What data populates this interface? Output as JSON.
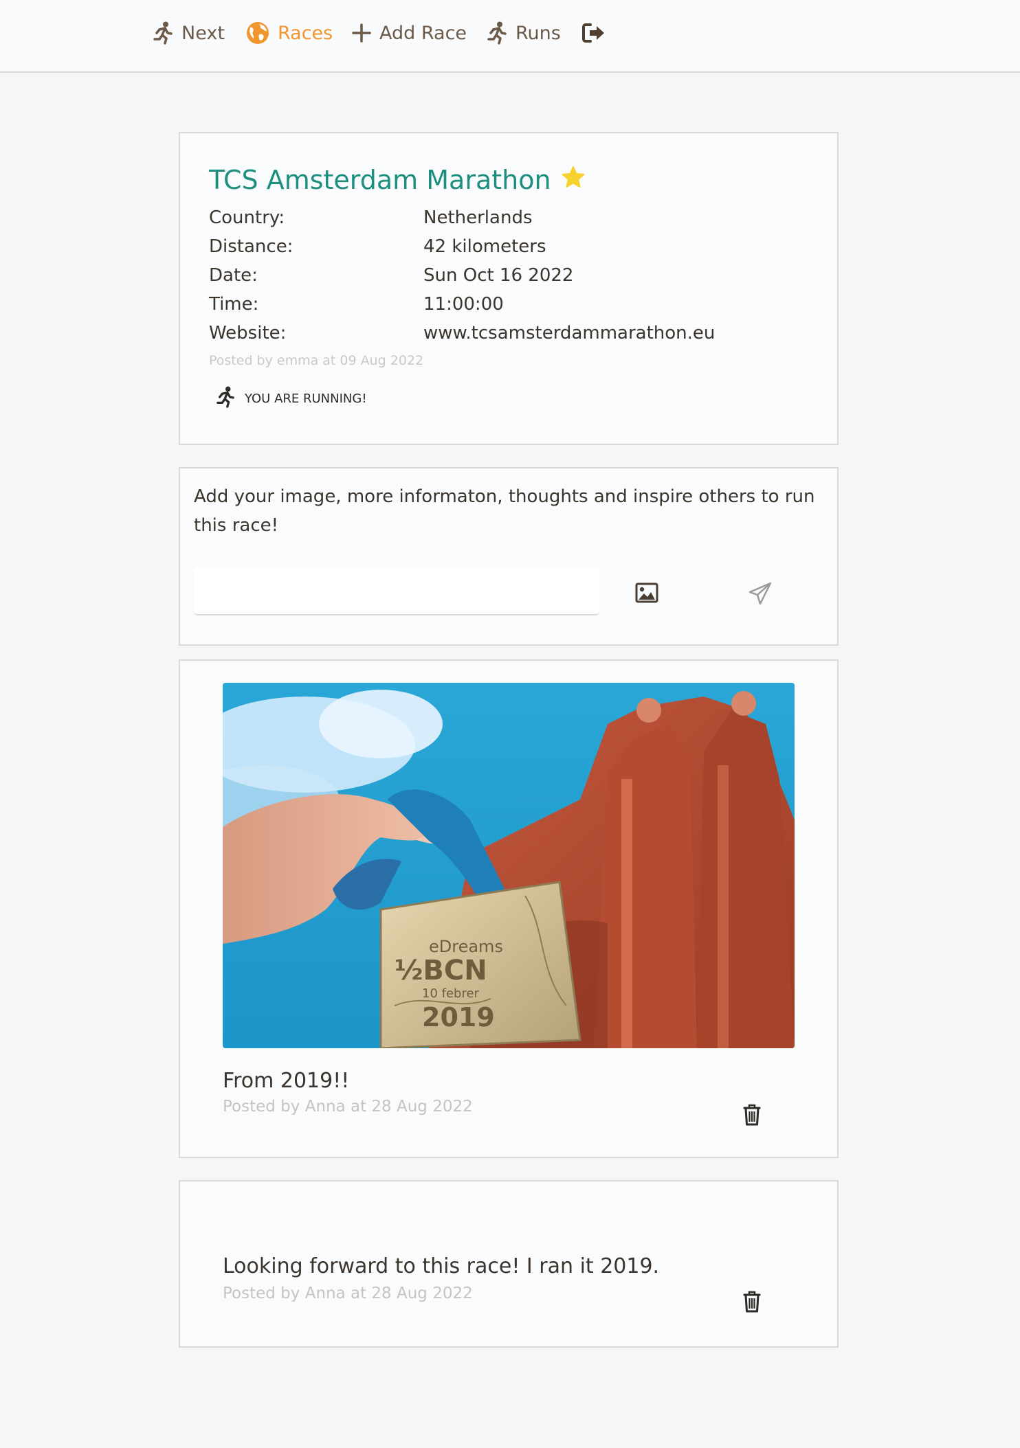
{
  "nav": {
    "items": [
      {
        "label": "Next",
        "icon": "runner-icon"
      },
      {
        "label": "Races",
        "icon": "globe-icon",
        "active": true
      },
      {
        "label": "Add Race",
        "icon": "plus-icon"
      },
      {
        "label": "Runs",
        "icon": "runner-icon"
      },
      {
        "label": "",
        "icon": "logout-icon"
      }
    ],
    "active_color": "#f0962f"
  },
  "race": {
    "title": "TCS Amsterdam Marathon",
    "favorite_icon": "star-icon",
    "fields": [
      {
        "label": "Country:",
        "value": "Netherlands"
      },
      {
        "label": "Distance:",
        "value": "42 kilometers"
      },
      {
        "label": "Date:",
        "value": "Sun Oct 16 2022"
      },
      {
        "label": "Time:",
        "value": "11:00:00"
      },
      {
        "label": "Website:",
        "value": "www.tcsamsterdammarathon.eu"
      }
    ],
    "posted": "Posted by emma at 09 Aug 2022",
    "running_status": "YOU ARE RUNNING!"
  },
  "compose": {
    "prompt": "Add your image, more informaton, thoughts and inspire others to run this race!",
    "input_value": "",
    "image_icon": "image-icon",
    "send_icon": "send-icon"
  },
  "posts": [
    {
      "has_image": true,
      "image_text": {
        "line1": "eDreams",
        "line2": "½BCN",
        "line3": "10 febrer",
        "line4": "2019"
      },
      "text": "From 2019!!",
      "meta": "Posted by Anna at 28 Aug 2022"
    },
    {
      "has_image": false,
      "text": "Looking forward to this race! I ran it 2019.",
      "meta": "Posted by Anna at 28 Aug 2022"
    }
  ]
}
